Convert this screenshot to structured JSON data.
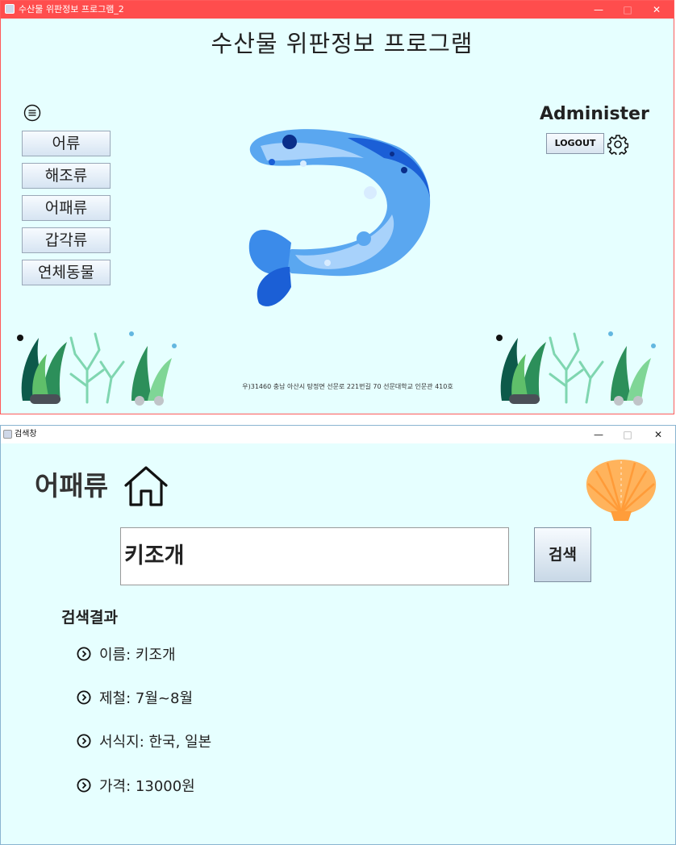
{
  "main_window": {
    "title": "수산물 위판정보 프로그램_2",
    "heading": "수산물 위판정보 프로그램",
    "controls": {
      "minimize": "—",
      "maximize": "□",
      "close": "✕"
    },
    "categories": [
      "어류",
      "해조류",
      "어패류",
      "갑각류",
      "연체동물"
    ],
    "user": {
      "name": "Administer",
      "logout_label": "LOGOUT"
    },
    "address": "우)31460 충남 아산시 탕정면 선문로 221번길 70 선문대학교 인문관 410호",
    "icons": {
      "menu": "menu-circle-icon",
      "settings": "gear-icon",
      "app": "java-app-icon"
    },
    "colors": {
      "titlebar": "#ff4d4d",
      "background": "#e6ffff"
    }
  },
  "search_window": {
    "title": "검색창",
    "controls": {
      "minimize": "—",
      "maximize": "□",
      "close": "✕"
    },
    "category": "어패류",
    "search": {
      "value": "키조개",
      "button_label": "검색"
    },
    "results": {
      "title": "검색결과",
      "rows": [
        {
          "label": "이름",
          "value": "키조개"
        },
        {
          "label": "제철",
          "value": "7월~8월"
        },
        {
          "label": "서식지",
          "value": "한국, 일본"
        },
        {
          "label": "가격",
          "value": "13000원"
        }
      ]
    },
    "icons": {
      "home": "home-icon",
      "row_bullet": "chevron-circle-icon",
      "shell": "scallop-icon"
    }
  }
}
